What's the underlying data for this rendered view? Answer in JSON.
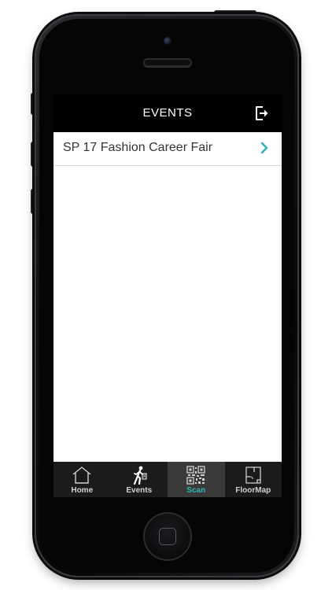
{
  "header": {
    "title": "EVENTS",
    "logout_icon": "logout-icon"
  },
  "events": [
    {
      "label": "SP 17 Fashion Career Fair"
    }
  ],
  "tabbar": {
    "tabs": [
      {
        "label": "Home",
        "icon": "house-icon",
        "active": false
      },
      {
        "label": "Events",
        "icon": "walking-person-icon",
        "active": false
      },
      {
        "label": "Scan",
        "icon": "qr-code-icon",
        "active": true
      },
      {
        "label": "FloorMap",
        "icon": "floor-map-icon",
        "active": false
      }
    ]
  },
  "colors": {
    "accent": "#2fb3b8",
    "navbar": "#000000",
    "tabbar": "#1b1b1b",
    "tab_active_bg": "#3a3a3a"
  }
}
